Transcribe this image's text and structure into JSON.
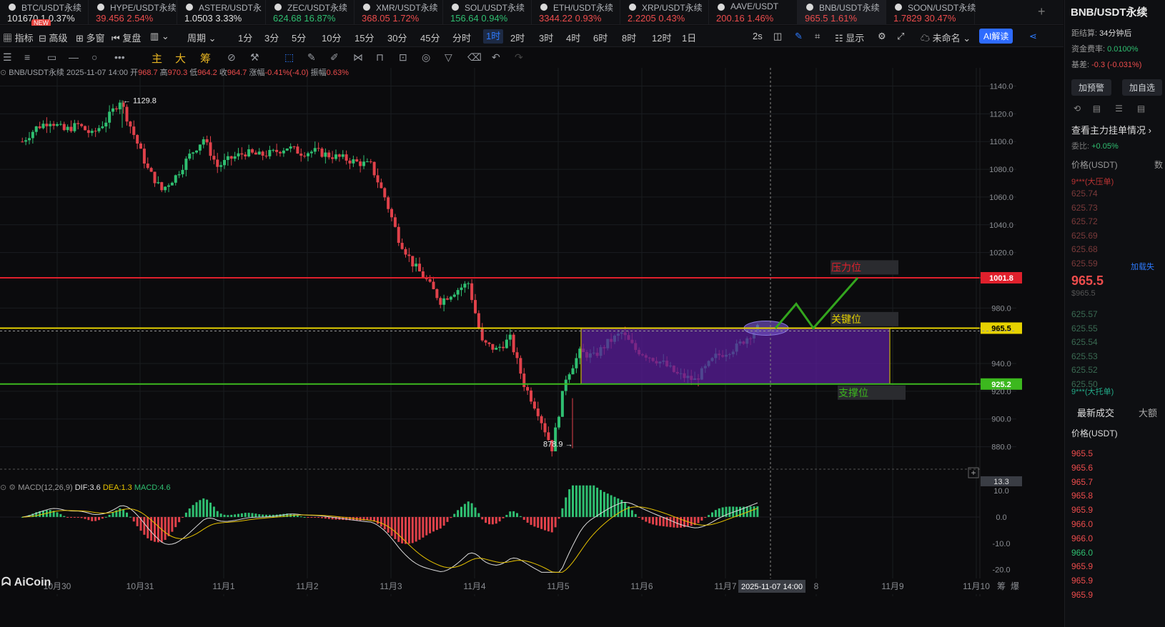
{
  "ticker_tabs": [
    {
      "name": "BTC/USDT永续",
      "price": "101670.1",
      "change": "0.37%",
      "color": "#e0e0e0",
      "new": "NEW"
    },
    {
      "name": "HYPE/USDT永续",
      "price": "39.456",
      "change": "2.54%",
      "color": "#ec4c4c"
    },
    {
      "name": "ASTER/USDT永",
      "price": "1.0503",
      "change": "3.33%",
      "color": "#e0e0e0"
    },
    {
      "name": "ZEC/USDT永续",
      "price": "624.68",
      "change": "16.87%",
      "color": "#2fbf71"
    },
    {
      "name": "XMR/USDT永续",
      "price": "368.05",
      "change": "1.72%",
      "color": "#ec4c4c"
    },
    {
      "name": "SOL/USDT永续",
      "price": "156.64",
      "change": "0.94%",
      "color": "#2fbf71"
    },
    {
      "name": "ETH/USDT永续",
      "price": "3344.22",
      "change": "0.93%",
      "color": "#ec4c4c"
    },
    {
      "name": "XRP/USDT永续",
      "price": "2.2205",
      "change": "0.43%",
      "color": "#ec4c4c"
    },
    {
      "name": "AAVE/USDT",
      "price": "200.16",
      "change": "1.46%",
      "color": "#ec4c4c"
    },
    {
      "name": "BNB/USDT永续",
      "price": "965.5",
      "change": "1.61%",
      "color": "#ec4c4c",
      "active": true
    },
    {
      "name": "SOON/USDT永续",
      "price": "1.7829",
      "change": "30.47%",
      "color": "#ec4c4c"
    }
  ],
  "toolbar": {
    "indicator": "指标",
    "advanced": "高级",
    "multi": "多窗",
    "replay": "复盘",
    "period": "周期",
    "periods": [
      "1分",
      "3分",
      "5分",
      "10分",
      "15分",
      "30分",
      "45分",
      "分时",
      "1时",
      "2时",
      "3时",
      "4时",
      "6时",
      "8时",
      "12时",
      "1日"
    ],
    "selected_period": "1时",
    "refresh": "2s",
    "display": "显示",
    "unnamed": "未命名",
    "ai": "AI解读"
  },
  "drawbar": {
    "main": "主",
    "big": "大",
    "chip": "筹"
  },
  "info": {
    "symbol": "BNB/USDT永续",
    "time": "2025-11-07 14:00",
    "open_label": "开",
    "open": "968.7",
    "high_label": "高",
    "high": "970.3",
    "low_label": "低",
    "low": "964.2",
    "close_label": "收",
    "close": "964.7",
    "chg_label": "涨幅",
    "chg": "-0.41%(-4.0)",
    "amp_label": "振幅",
    "amp": "0.63%"
  },
  "macd_info": {
    "name": "MACD(12,26,9)",
    "dif": "DIF:3.6",
    "dea": "DEA:1.3",
    "macd": "MACD:4.6",
    "colors": {
      "dif": "#e0e0e0",
      "dea": "#e6c200",
      "macd": "#2fbf71"
    }
  },
  "logo": "AiCoin",
  "chart_data": {
    "type": "candlestick",
    "symbol": "BNB/USDT永续",
    "timeframe": "1时",
    "y_ticks": [
      1140.0,
      1120.0,
      1100.0,
      1080.0,
      1060.0,
      1040.0,
      1020.0,
      1001.8,
      980.0,
      965.5,
      940.0,
      925.2,
      920.0,
      900.0,
      880.0
    ],
    "ylim": [
      870,
      1148
    ],
    "x_labels": [
      "10月30",
      "10月31",
      "11月1",
      "11月2",
      "11月3",
      "11月4",
      "11月5",
      "11月6",
      "11月7",
      "8",
      "11月9",
      "11月10"
    ],
    "crosshair_time": "2025-11-07 14:00",
    "annotations": {
      "high": "1129.8",
      "low": "878.9"
    },
    "levels": {
      "resistance": {
        "label": "压力位",
        "value": 1001.8,
        "color": "#e0202c"
      },
      "key": {
        "label": "关键位",
        "value": 965.5,
        "color": "#e6d200"
      },
      "support": {
        "label": "支撑位",
        "value": 925.2,
        "color": "#3cb81e"
      }
    },
    "range_box": {
      "from": "11月5",
      "to": "11月8",
      "top": 965.5,
      "bottom": 925.2,
      "color": "#5a1e9a"
    },
    "forecast_path": [
      965.5,
      983,
      965.5,
      1001.8
    ],
    "colors": {
      "up": "#2fbf71",
      "down": "#e0414a",
      "grid": "#1a1c20"
    },
    "anchors": [
      [
        "10月30",
        1100
      ],
      [
        "10月30",
        1110
      ],
      [
        "10月30",
        1115
      ],
      [
        "10月30",
        1108
      ],
      [
        "10月30",
        1112
      ],
      [
        "10月30",
        1105
      ],
      [
        "10月31",
        1115
      ],
      [
        "10月31",
        1129.8
      ],
      [
        "10月31",
        1105
      ],
      [
        "10月31",
        1080
      ],
      [
        "10月31",
        1065
      ],
      [
        "10月31",
        1075
      ],
      [
        "11月1",
        1090
      ],
      [
        "11月1",
        1102
      ],
      [
        "11月1",
        1082
      ],
      [
        "11月1",
        1088
      ],
      [
        "11月1",
        1092
      ],
      [
        "11月1",
        1090
      ],
      [
        "11月2",
        1092
      ],
      [
        "11月2",
        1096
      ],
      [
        "11月2",
        1092
      ],
      [
        "11月2",
        1093
      ],
      [
        "11月2",
        1090
      ],
      [
        "11月2",
        1088
      ],
      [
        "11月3",
        1085
      ],
      [
        "11月3",
        1083
      ],
      [
        "11月3",
        1060
      ],
      [
        "11月3",
        1030
      ],
      [
        "11月3",
        1012
      ],
      [
        "11月3",
        1000
      ],
      [
        "11月4",
        985
      ],
      [
        "11月4",
        992
      ],
      [
        "11月4",
        998
      ],
      [
        "11月4",
        955
      ],
      [
        "11月4",
        950
      ],
      [
        "11月4",
        958
      ],
      [
        "11月5",
        925
      ],
      [
        "11月5",
        905
      ],
      [
        "11月5",
        878.9
      ],
      [
        "11月5",
        930
      ],
      [
        "11月5",
        948
      ],
      [
        "11月5",
        945
      ],
      [
        "11月6",
        955
      ],
      [
        "11月6",
        962
      ],
      [
        "11月6",
        950
      ],
      [
        "11月6",
        945
      ],
      [
        "11月6",
        940
      ],
      [
        "11月6",
        932
      ],
      [
        "11月7",
        928
      ],
      [
        "11月7",
        945
      ],
      [
        "11月7",
        952
      ],
      [
        "11月7",
        965.5
      ]
    ],
    "macd": {
      "y_ticks": [
        13.3,
        10.0,
        0.0,
        -10.0,
        -20.0
      ],
      "ylim": [
        -22,
        16
      ],
      "dif": 3.6,
      "dea": 1.3,
      "macd": 4.6
    }
  },
  "side": {
    "title": "BNB/USDT永续",
    "settle_label": "距结算:",
    "settle": "34分钟后",
    "fund_label": "资金费率:",
    "fund": "0.0100%",
    "basis_label": "基差:",
    "basis": "-0.3 (-0.031%)",
    "alert": "加预警",
    "watch": "加自选",
    "book_title": "查看主力挂单情况",
    "ratio_label": "委比:",
    "ratio": "+0.05%",
    "price_header": "价格(USDT)",
    "qty_header": "数",
    "ask_big": "9***(大压单)",
    "asks": [
      "625.74",
      "625.73",
      "625.72",
      "625.69",
      "625.68",
      "625.59"
    ],
    "load_fail": "加载失",
    "mid": "965.5",
    "mid_sub": "$965.5",
    "bids": [
      "625.57",
      "625.55",
      "625.54",
      "625.53",
      "625.52",
      "625.50"
    ],
    "bid_big": "9***(大托单)",
    "trades_title": "最新成交",
    "big_tab": "大额",
    "trade_header": "价格(USDT)",
    "trades": [
      "965.5",
      "965.6",
      "965.7",
      "965.8",
      "965.9",
      "966.0",
      "966.0",
      "966.0",
      "965.9",
      "965.9",
      "965.9"
    ],
    "trade_colors": [
      "#ec4c4c",
      "#ec4c4c",
      "#ec4c4c",
      "#ec4c4c",
      "#ec4c4c",
      "#ec4c4c",
      "#ec4c4c",
      "#2fbf71",
      "#ec4c4c",
      "#ec4c4c",
      "#ec4c4c"
    ]
  }
}
